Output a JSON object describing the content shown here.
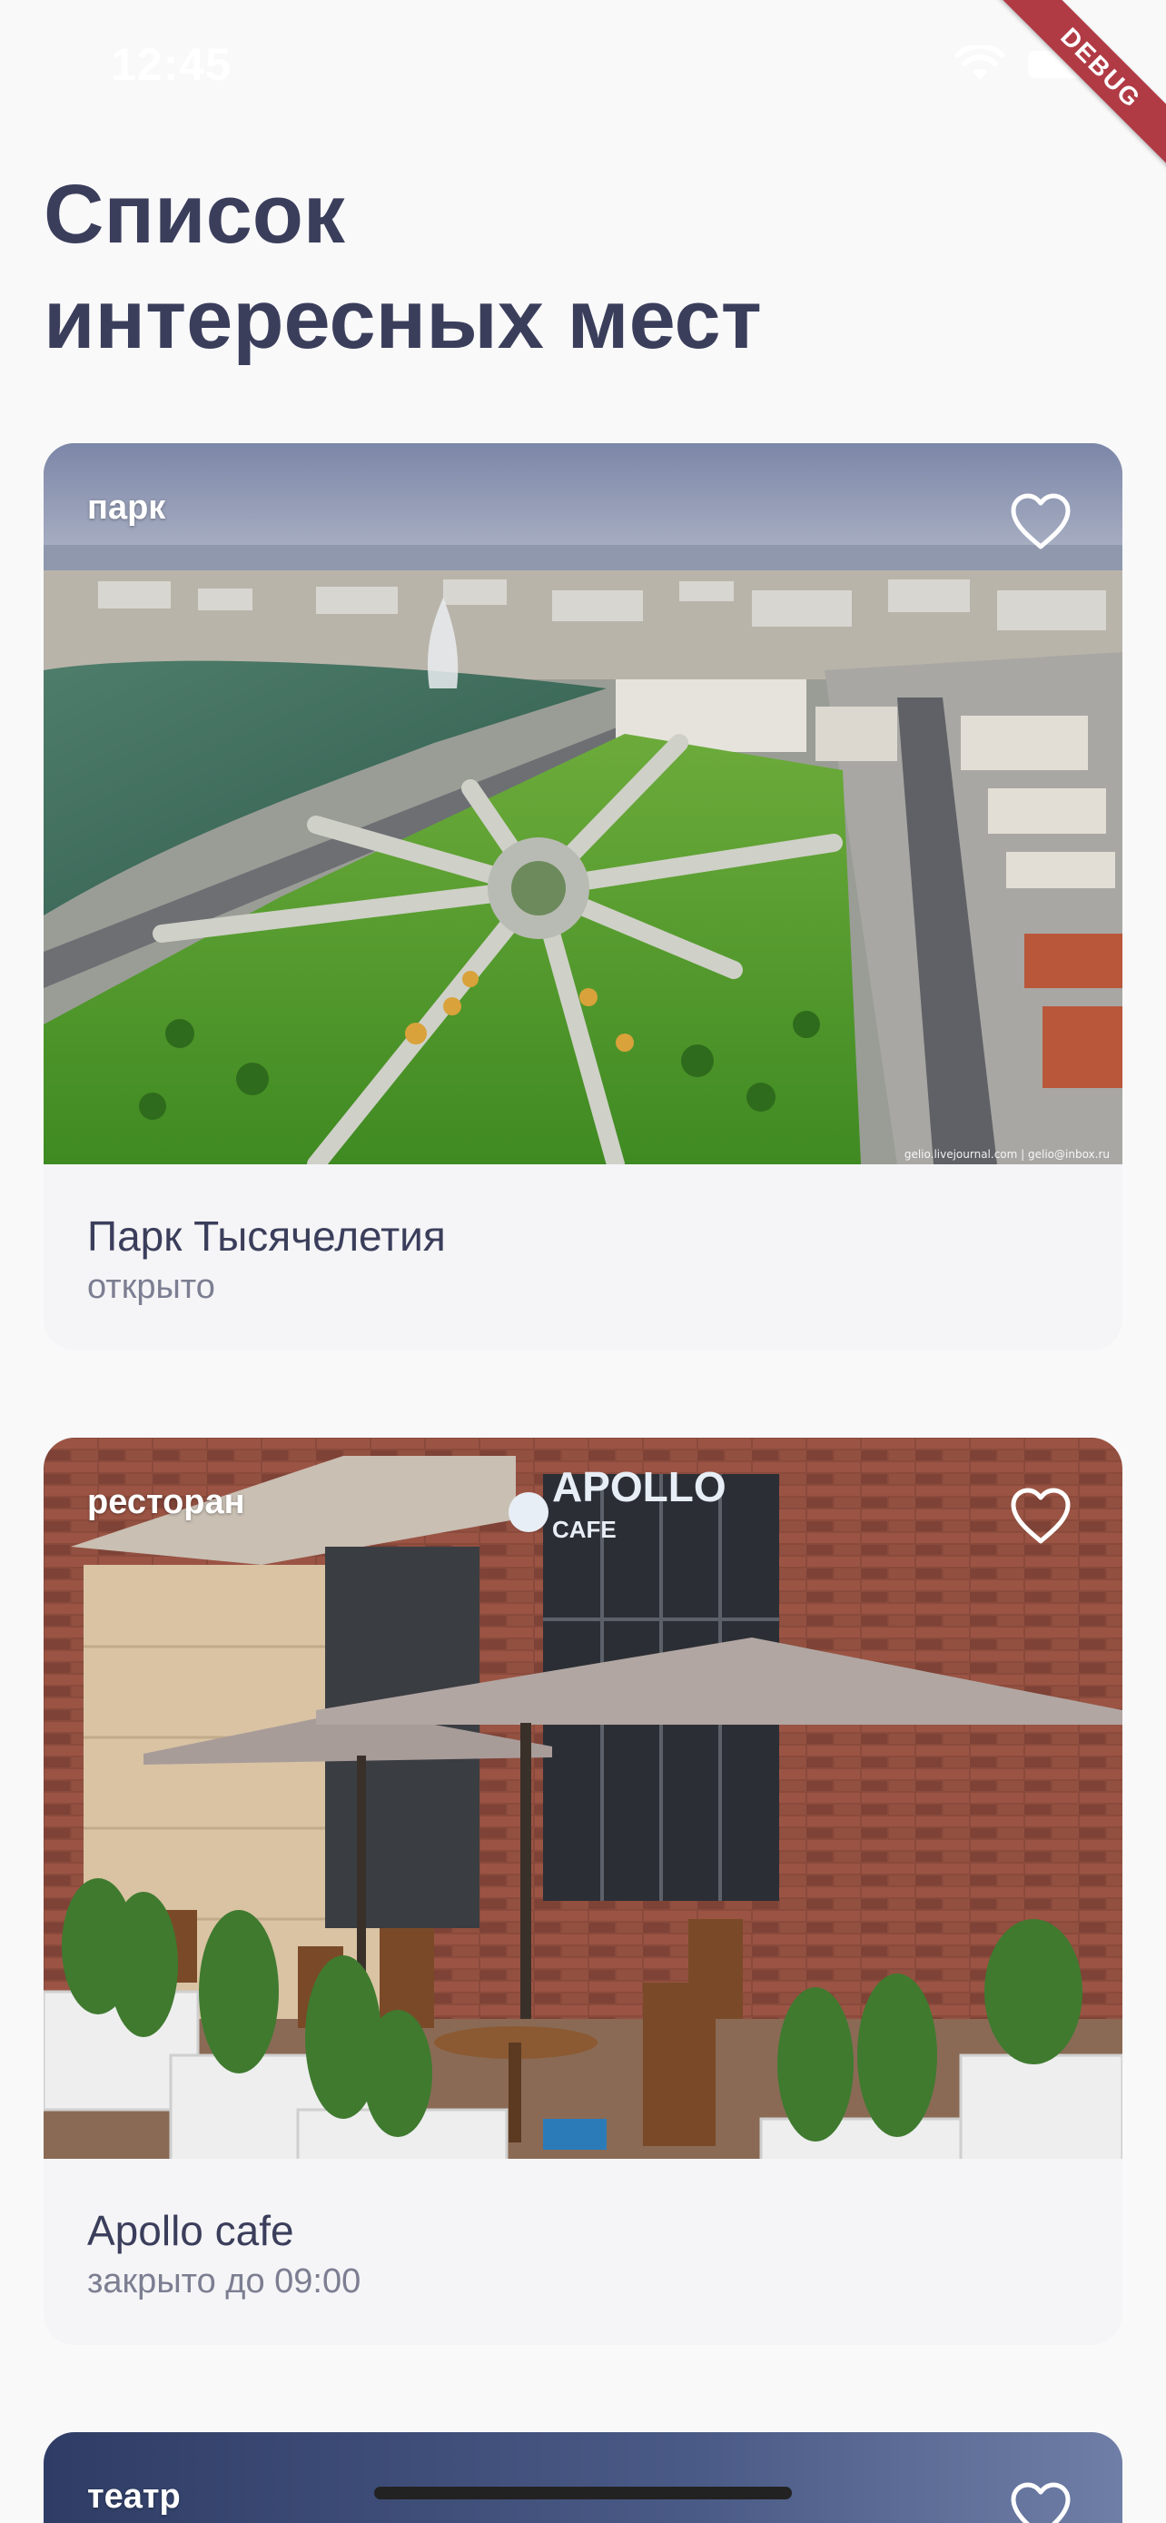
{
  "status_bar": {
    "time": "12:45"
  },
  "debug_banner": "DEBUG",
  "page": {
    "title": "Список\nинтересных мест"
  },
  "places": [
    {
      "type": "парк",
      "name": "Парк Тысячелетия",
      "status": "открыто",
      "photo_credit": "gelio.livejournal.com  |  gelio@inbox.ru"
    },
    {
      "type": "ресторан",
      "name": "Apollo cafe",
      "status": "закрыто до 09:00",
      "sign_text": "APOLLO",
      "sign_subtext": "CAFE"
    },
    {
      "type": "театр"
    }
  ],
  "colors": {
    "title": "#3b3e5b",
    "subtitle": "#7c7e92",
    "card_background": "#f5f5f7",
    "debug_banner": "#b13b45"
  },
  "icons": {
    "favorite": "heart-outline-icon",
    "wifi": "wifi-icon",
    "battery": "battery-icon"
  }
}
